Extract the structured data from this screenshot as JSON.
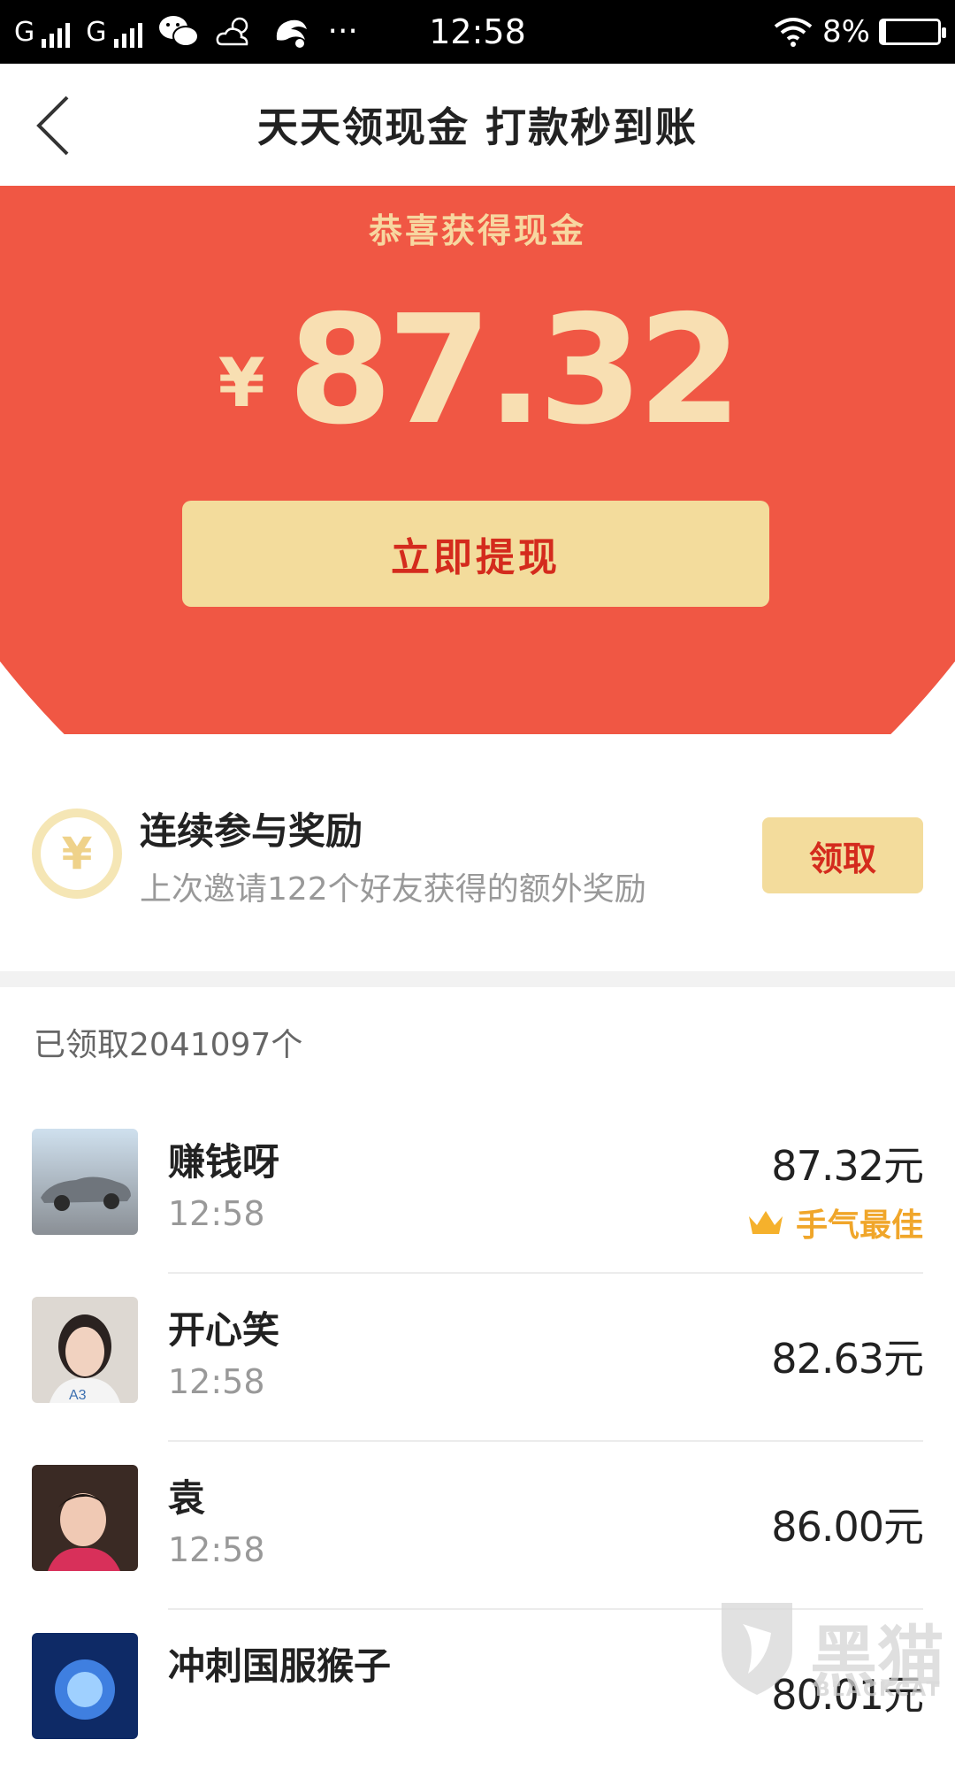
{
  "status_bar": {
    "carrier1": "G",
    "carrier2": "G",
    "time": "12:58",
    "battery": "8%",
    "more": "···"
  },
  "nav": {
    "title": "天天领现金 打款秒到账"
  },
  "hero": {
    "subtitle": "恭喜获得现金",
    "currency": "¥",
    "amount": "87.32",
    "withdraw_label": "立即提现",
    "bg_color": "#f05744",
    "gold_color": "#f3dc9c"
  },
  "reward": {
    "icon_glyph": "¥",
    "title": "连续参与奖励",
    "description": "上次邀请122个好友获得的额外奖励",
    "claim_label": "领取"
  },
  "claimed_count": "已领取2041097个",
  "records": [
    {
      "name": "赚钱呀",
      "time": "12:58",
      "amount": "87.32元",
      "badge": "手气最佳",
      "avatar": "car-avatar"
    },
    {
      "name": "开心笑",
      "time": "12:58",
      "amount": "82.63元",
      "avatar": "woman-avatar"
    },
    {
      "name": "袁",
      "time": "12:58",
      "amount": "86.00元",
      "avatar": "baby-avatar"
    },
    {
      "name": "冲刺国服猴子",
      "time": "",
      "amount": "80.01元",
      "avatar": "game-avatar"
    }
  ],
  "watermark": {
    "text": "黑猫",
    "sub": "BLACKCAT"
  }
}
